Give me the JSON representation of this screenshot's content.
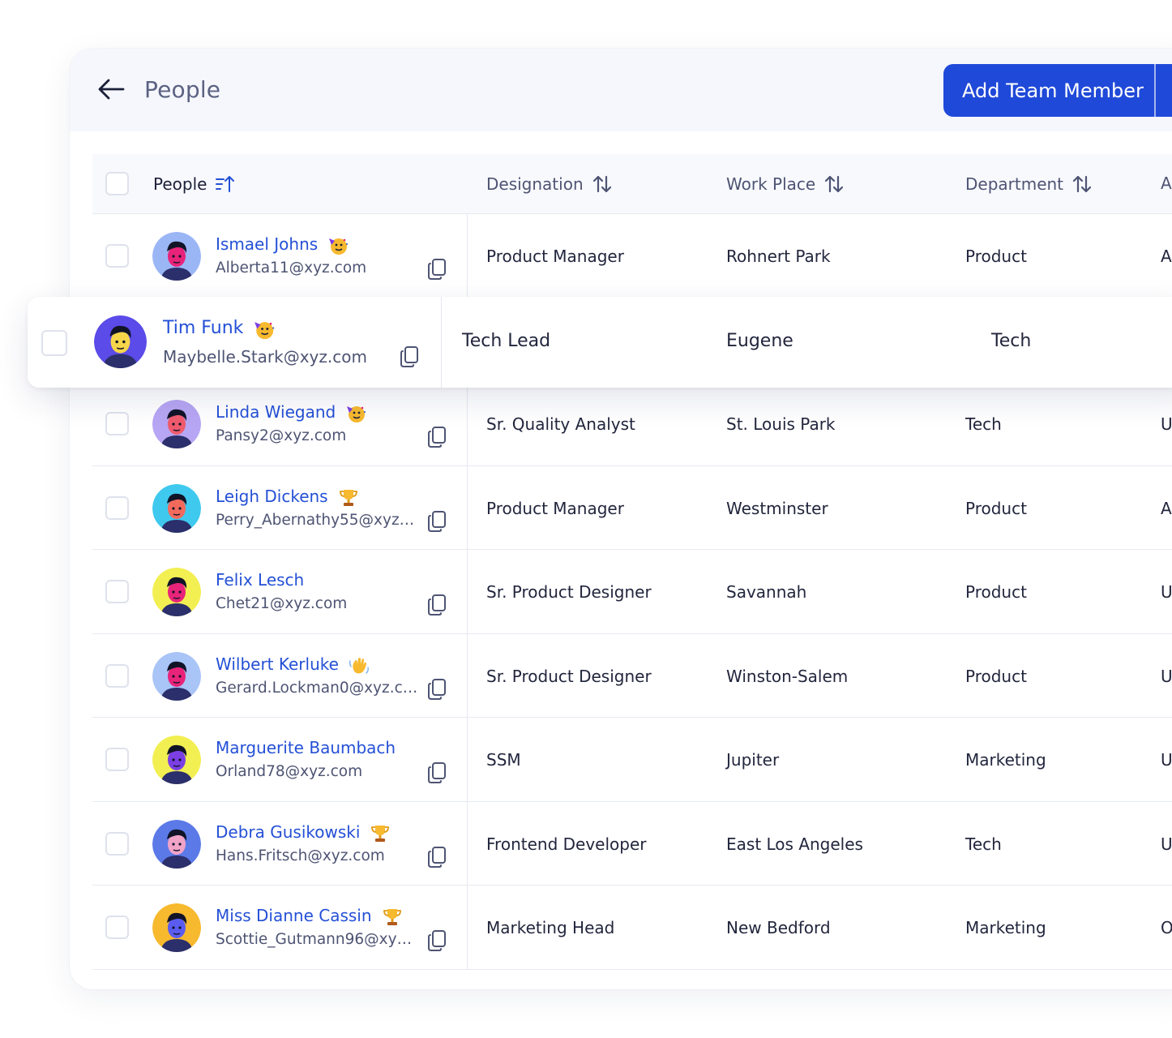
{
  "header": {
    "title": "People",
    "add_button_label": "Add Team Member"
  },
  "columns": {
    "people": "People",
    "designation": "Designation",
    "workplace": "Work Place",
    "department": "Department",
    "next": "A"
  },
  "rows": [
    {
      "name": "Ismael Johns",
      "email": "Alberta11@xyz.com",
      "badge": "party",
      "designation": "Product Manager",
      "workplace": "Rohnert Park",
      "department": "Product",
      "next": "A",
      "avatar_bg": "#9bb6f5",
      "skin": "#e8247a"
    },
    {
      "name": "Tim Funk",
      "email": "Maybelle.Stark@xyz.com",
      "badge": "party",
      "designation": "Tech Lead",
      "workplace": "Eugene",
      "department": "Tech",
      "next": "",
      "avatar_bg": "#5b4be8",
      "skin": "#f7d54a"
    },
    {
      "name": "Linda Wiegand",
      "email": "Pansy2@xyz.com",
      "badge": "party",
      "designation": "Sr. Quality Analyst",
      "workplace": "St. Louis Park",
      "department": "Tech",
      "next": "U",
      "avatar_bg": "#b7a6f3",
      "skin": "#ef5b6d"
    },
    {
      "name": "Leigh Dickens",
      "email": "Perry_Abernathy55@xyz.c...",
      "badge": "trophy",
      "designation": "Product Manager",
      "workplace": "Westminster",
      "department": "Product",
      "next": "A",
      "avatar_bg": "#3fc9ee",
      "skin": "#f26a5c"
    },
    {
      "name": "Felix Lesch",
      "email": "Chet21@xyz.com",
      "badge": "",
      "designation": "Sr. Product Designer",
      "workplace": "Savannah",
      "department": "Product",
      "next": "U",
      "avatar_bg": "#f2ef52",
      "skin": "#e8247a"
    },
    {
      "name": "Wilbert Kerluke",
      "email": "Gerard.Lockman0@xyz.co...",
      "badge": "wave",
      "designation": "Sr. Product Designer",
      "workplace": "Winston-Salem",
      "department": "Product",
      "next": "U",
      "avatar_bg": "#a9c4f7",
      "skin": "#e8247a"
    },
    {
      "name": "Marguerite Baumbach",
      "email": "Orland78@xyz.com",
      "badge": "",
      "designation": "SSM",
      "workplace": "Jupiter",
      "department": "Marketing",
      "next": "U",
      "avatar_bg": "#f2ef52",
      "skin": "#7b3fe4"
    },
    {
      "name": "Debra Gusikowski",
      "email": "Hans.Fritsch@xyz.com",
      "badge": "trophy",
      "designation": "Frontend Developer",
      "workplace": "East Los Angeles",
      "department": "Tech",
      "next": "U",
      "avatar_bg": "#5b7ae8",
      "skin": "#f2a3c8"
    },
    {
      "name": "Miss Dianne Cassin",
      "email": "Scottie_Gutmann96@xyz.c...",
      "badge": "trophy",
      "designation": "Marketing Head",
      "workplace": "New Bedford",
      "department": "Marketing",
      "next": "O",
      "avatar_bg": "#f7b92e",
      "skin": "#5a5cf0"
    }
  ],
  "colors": {
    "accent": "#1f49d8",
    "link": "#2450d6",
    "header_bg": "#f5f7fd"
  }
}
